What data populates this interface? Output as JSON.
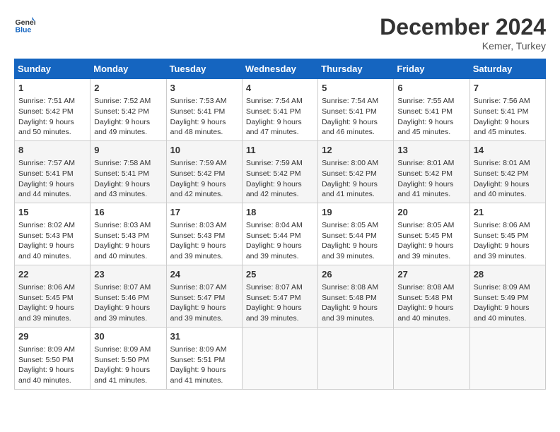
{
  "header": {
    "logo_general": "General",
    "logo_blue": "Blue",
    "month_title": "December 2024",
    "location": "Kemer, Turkey"
  },
  "days_of_week": [
    "Sunday",
    "Monday",
    "Tuesday",
    "Wednesday",
    "Thursday",
    "Friday",
    "Saturday"
  ],
  "weeks": [
    [
      {
        "day": "1",
        "sunrise": "7:51 AM",
        "sunset": "5:42 PM",
        "daylight": "9 hours and 50 minutes."
      },
      {
        "day": "2",
        "sunrise": "7:52 AM",
        "sunset": "5:42 PM",
        "daylight": "9 hours and 49 minutes."
      },
      {
        "day": "3",
        "sunrise": "7:53 AM",
        "sunset": "5:41 PM",
        "daylight": "9 hours and 48 minutes."
      },
      {
        "day": "4",
        "sunrise": "7:54 AM",
        "sunset": "5:41 PM",
        "daylight": "9 hours and 47 minutes."
      },
      {
        "day": "5",
        "sunrise": "7:54 AM",
        "sunset": "5:41 PM",
        "daylight": "9 hours and 46 minutes."
      },
      {
        "day": "6",
        "sunrise": "7:55 AM",
        "sunset": "5:41 PM",
        "daylight": "9 hours and 45 minutes."
      },
      {
        "day": "7",
        "sunrise": "7:56 AM",
        "sunset": "5:41 PM",
        "daylight": "9 hours and 45 minutes."
      }
    ],
    [
      {
        "day": "8",
        "sunrise": "7:57 AM",
        "sunset": "5:41 PM",
        "daylight": "9 hours and 44 minutes."
      },
      {
        "day": "9",
        "sunrise": "7:58 AM",
        "sunset": "5:41 PM",
        "daylight": "9 hours and 43 minutes."
      },
      {
        "day": "10",
        "sunrise": "7:59 AM",
        "sunset": "5:42 PM",
        "daylight": "9 hours and 42 minutes."
      },
      {
        "day": "11",
        "sunrise": "7:59 AM",
        "sunset": "5:42 PM",
        "daylight": "9 hours and 42 minutes."
      },
      {
        "day": "12",
        "sunrise": "8:00 AM",
        "sunset": "5:42 PM",
        "daylight": "9 hours and 41 minutes."
      },
      {
        "day": "13",
        "sunrise": "8:01 AM",
        "sunset": "5:42 PM",
        "daylight": "9 hours and 41 minutes."
      },
      {
        "day": "14",
        "sunrise": "8:01 AM",
        "sunset": "5:42 PM",
        "daylight": "9 hours and 40 minutes."
      }
    ],
    [
      {
        "day": "15",
        "sunrise": "8:02 AM",
        "sunset": "5:43 PM",
        "daylight": "9 hours and 40 minutes."
      },
      {
        "day": "16",
        "sunrise": "8:03 AM",
        "sunset": "5:43 PM",
        "daylight": "9 hours and 40 minutes."
      },
      {
        "day": "17",
        "sunrise": "8:03 AM",
        "sunset": "5:43 PM",
        "daylight": "9 hours and 39 minutes."
      },
      {
        "day": "18",
        "sunrise": "8:04 AM",
        "sunset": "5:44 PM",
        "daylight": "9 hours and 39 minutes."
      },
      {
        "day": "19",
        "sunrise": "8:05 AM",
        "sunset": "5:44 PM",
        "daylight": "9 hours and 39 minutes."
      },
      {
        "day": "20",
        "sunrise": "8:05 AM",
        "sunset": "5:45 PM",
        "daylight": "9 hours and 39 minutes."
      },
      {
        "day": "21",
        "sunrise": "8:06 AM",
        "sunset": "5:45 PM",
        "daylight": "9 hours and 39 minutes."
      }
    ],
    [
      {
        "day": "22",
        "sunrise": "8:06 AM",
        "sunset": "5:45 PM",
        "daylight": "9 hours and 39 minutes."
      },
      {
        "day": "23",
        "sunrise": "8:07 AM",
        "sunset": "5:46 PM",
        "daylight": "9 hours and 39 minutes."
      },
      {
        "day": "24",
        "sunrise": "8:07 AM",
        "sunset": "5:47 PM",
        "daylight": "9 hours and 39 minutes."
      },
      {
        "day": "25",
        "sunrise": "8:07 AM",
        "sunset": "5:47 PM",
        "daylight": "9 hours and 39 minutes."
      },
      {
        "day": "26",
        "sunrise": "8:08 AM",
        "sunset": "5:48 PM",
        "daylight": "9 hours and 39 minutes."
      },
      {
        "day": "27",
        "sunrise": "8:08 AM",
        "sunset": "5:48 PM",
        "daylight": "9 hours and 40 minutes."
      },
      {
        "day": "28",
        "sunrise": "8:09 AM",
        "sunset": "5:49 PM",
        "daylight": "9 hours and 40 minutes."
      }
    ],
    [
      {
        "day": "29",
        "sunrise": "8:09 AM",
        "sunset": "5:50 PM",
        "daylight": "9 hours and 40 minutes."
      },
      {
        "day": "30",
        "sunrise": "8:09 AM",
        "sunset": "5:50 PM",
        "daylight": "9 hours and 41 minutes."
      },
      {
        "day": "31",
        "sunrise": "8:09 AM",
        "sunset": "5:51 PM",
        "daylight": "9 hours and 41 minutes."
      },
      null,
      null,
      null,
      null
    ]
  ],
  "labels": {
    "sunrise": "Sunrise:",
    "sunset": "Sunset:",
    "daylight": "Daylight:"
  }
}
